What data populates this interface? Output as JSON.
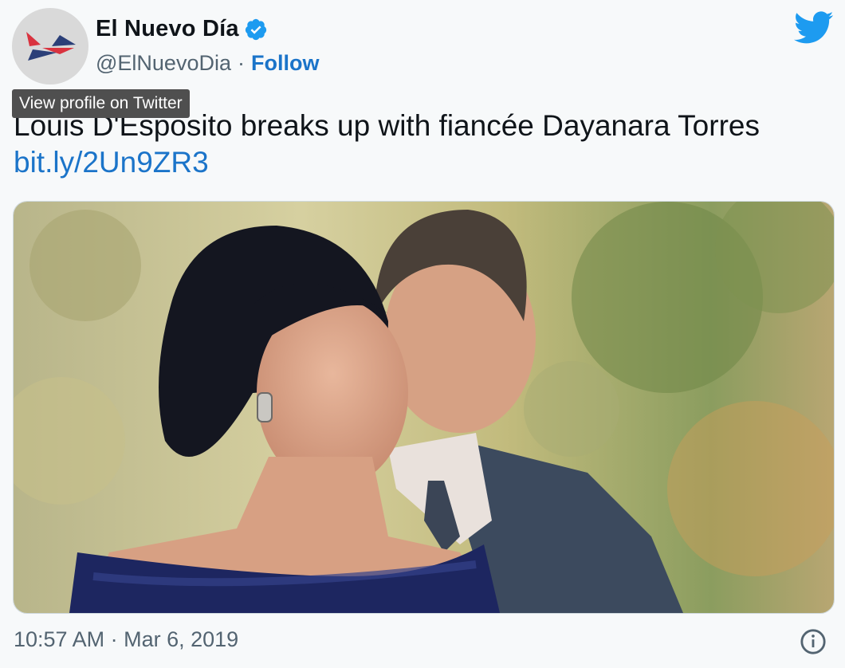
{
  "account": {
    "display_name": "El Nuevo Día",
    "handle": "@ElNuevoDia",
    "separator": "·",
    "follow_label": "Follow",
    "verified": true
  },
  "tooltip": {
    "text": "View profile on Twitter"
  },
  "tweet": {
    "text": "Louis D'Esposito breaks up with fiancée Dayanara Torres",
    "link": "bit.ly/2Un9ZR3",
    "timestamp": "10:57 AM · Mar 6, 2019"
  },
  "icons": {
    "logo": "twitter-bird-icon",
    "verified": "verified-badge-icon",
    "info": "info-icon",
    "avatar": "el-nuevo-dia-logo"
  },
  "colors": {
    "twitter_blue": "#1d9bf0",
    "link_blue": "#1b74c9",
    "background": "#f7f9fa",
    "secondary_text": "#536471"
  }
}
